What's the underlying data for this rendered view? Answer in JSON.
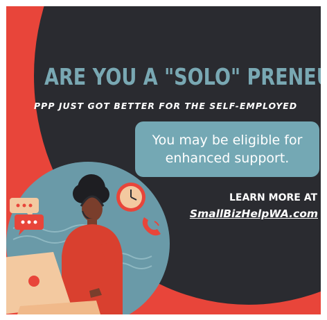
{
  "headline": "ARE YOU A \"SOLO\" PRENEUR?",
  "subheadline": "PPP JUST GOT BETTER FOR THE SELF-EMPLOYED",
  "callout": "You may be eligible for enhanced support.",
  "cta": {
    "line1": "LEARN MORE AT",
    "link": "SmallBizHelpWA.com"
  },
  "colors": {
    "background_red": "#e8453a",
    "dark_blob": "#2a2b30",
    "accent_teal": "#74a8b4",
    "text_white": "#ffffff"
  },
  "illustration": {
    "subject": "woman-on-laptop-with-headset",
    "icons": [
      "clock-icon",
      "phone-icon",
      "chat-bubble-icon",
      "chat-bubble-icon"
    ]
  }
}
